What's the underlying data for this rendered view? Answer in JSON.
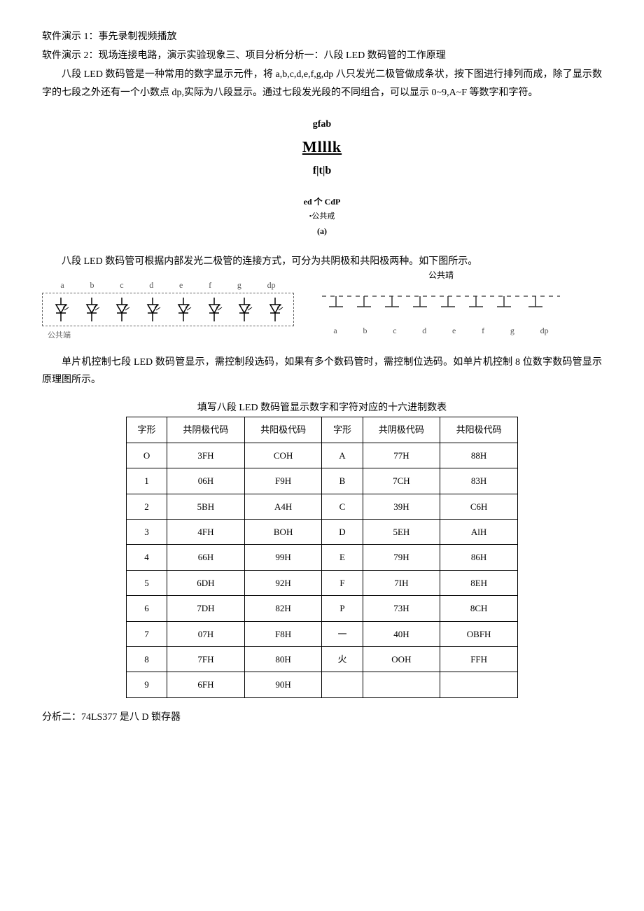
{
  "lines": {
    "l1": "软件演示 1：事先录制视频播放",
    "l2": "软件演示 2：现场连接电路，演示实验现象三、项目分析分析一：八段 LED 数码管的工作原理",
    "p1": "八段 LED 数码管是一种常用的数字显示元件，将 a,b,c,d,e,f,g,dp 八只发光二极管做成条状，按下图进行排列而成，除了显示数字的七段之外还有一个小数点 dp,实际为八段显示。通过七段发光段的不同组合，可以显示 0~9,A~F 等数字和字符。",
    "d1": "gfab",
    "d2": "Mlllk",
    "d3": "f|t|b",
    "d4": "ed 个 CdP",
    "d5": "•公共戒",
    "d6": "(a)",
    "p2": "八段 LED 数码管可根据内部发光二极管的连接方式，可分为共阴极和共阳极两种。如下图所示。",
    "right_label": "公共靖",
    "left_bottom": "公共端",
    "p3": "单片机控制七段 LED 数码管显示，需控制段选码，如果有多个数码管时，需控制位选码。如单片机控制 8 位数字数码管显示原理图所示。",
    "table_caption": "填写八段 LED 数码管显示数字和字符对应的十六进制数表",
    "l_final": "分析二：74LS377 是八 D 锁存器"
  },
  "pin_labels": [
    "a",
    "b",
    "c",
    "d",
    "e",
    "f",
    "g",
    "dp"
  ],
  "table": {
    "headers": [
      "字形",
      "共阴极代码",
      "共阳极代码",
      "字形",
      "共阴极代码",
      "共阳极代码"
    ],
    "rows": [
      [
        "O",
        "3FH",
        "COH",
        "A",
        "77H",
        "88H"
      ],
      [
        "1",
        "06H",
        "F9H",
        "B",
        "7CH",
        "83H"
      ],
      [
        "2",
        "5BH",
        "A4H",
        "C",
        "39H",
        "C6H"
      ],
      [
        "3",
        "4FH",
        "BOH",
        "D",
        "5EH",
        "AlH"
      ],
      [
        "4",
        "66H",
        "99H",
        "E",
        "79H",
        "86H"
      ],
      [
        "5",
        "6DH",
        "92H",
        "F",
        "7IH",
        "8EH"
      ],
      [
        "6",
        "7DH",
        "82H",
        "P",
        "73H",
        "8CH"
      ],
      [
        "7",
        "07H",
        "F8H",
        "一",
        "40H",
        "OBFH"
      ],
      [
        "8",
        "7FH",
        "80H",
        "火",
        "OOH",
        "FFH"
      ],
      [
        "9",
        "6FH",
        "90H",
        "",
        "",
        ""
      ]
    ]
  }
}
